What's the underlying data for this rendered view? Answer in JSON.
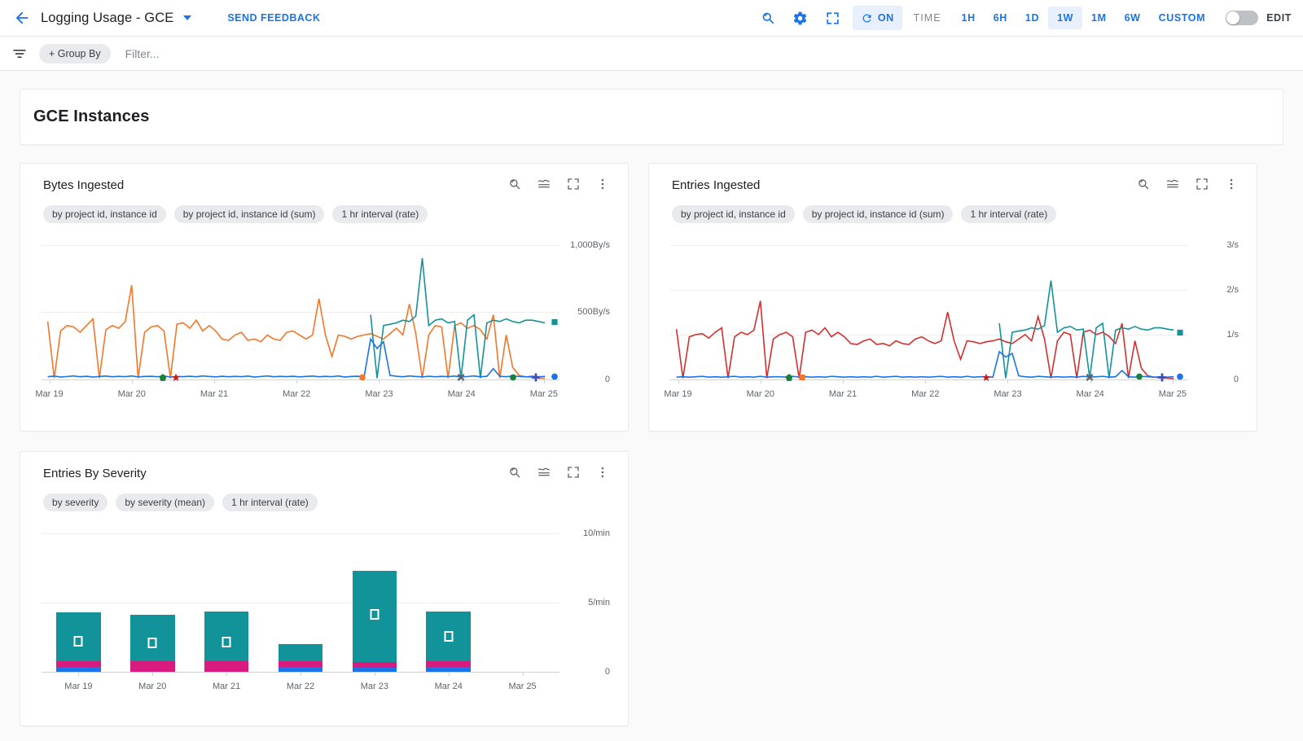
{
  "topbar": {
    "back_icon": "arrow-back-icon",
    "title": "Logging Usage - GCE",
    "caret_icon": "chevron-down-icon",
    "send_feedback": "SEND FEEDBACK",
    "icons": [
      {
        "name": "zoom-out-icon",
        "label": "zoom-out"
      },
      {
        "name": "settings-gear-icon",
        "label": "settings"
      },
      {
        "name": "fullscreen-icon",
        "label": "fullscreen"
      }
    ],
    "auto_refresh": {
      "icon": "refresh-icon",
      "label": "ON"
    },
    "time_label": "TIME",
    "ranges": [
      {
        "label": "1H",
        "active": false
      },
      {
        "label": "6H",
        "active": false
      },
      {
        "label": "1D",
        "active": false
      },
      {
        "label": "1W",
        "active": true
      },
      {
        "label": "1M",
        "active": false
      },
      {
        "label": "6W",
        "active": false
      },
      {
        "label": "CUSTOM",
        "active": false
      }
    ],
    "edit_toggle": {
      "state": "off",
      "label": "EDIT"
    },
    "accent_color": "#1a73e8",
    "active_bg": "#e8f0fe"
  },
  "filterbar": {
    "filter_icon": "filter-list-icon",
    "group_by": "+ Group By",
    "filter_placeholder": "Filter..."
  },
  "section": {
    "title": "GCE Instances"
  },
  "cards": [
    {
      "id": "bytes-ingested",
      "title": "Bytes Ingested",
      "chips": [
        "by project id, instance id",
        "by project id, instance id (sum)",
        "1 hr interval (rate)"
      ],
      "tools": [
        "zoom-out-icon",
        "chart-type-icon",
        "fullscreen-icon",
        "more-vert-icon"
      ]
    },
    {
      "id": "entries-ingested",
      "title": "Entries Ingested",
      "chips": [
        "by project id, instance id",
        "by project id, instance id (sum)",
        "1 hr interval (rate)"
      ],
      "tools": [
        "zoom-out-icon",
        "chart-type-icon",
        "fullscreen-icon",
        "more-vert-icon"
      ]
    },
    {
      "id": "entries-by-severity",
      "title": "Entries By Severity",
      "chips": [
        "by severity",
        "by severity (mean)",
        "1 hr interval (rate)"
      ],
      "tools": [
        "zoom-out-icon",
        "chart-type-icon",
        "fullscreen-icon",
        "more-vert-icon"
      ]
    }
  ],
  "chart_data": [
    {
      "type": "line",
      "title": "Bytes Ingested",
      "xlabel": "",
      "ylabel": "By/s",
      "ylim": [
        0,
        1100
      ],
      "yticks": [
        0,
        500,
        1000
      ],
      "ytick_labels": [
        "0",
        "500By/s",
        "1,000By/s"
      ],
      "grid": true,
      "legend": "none",
      "xticks": [
        "Mar 19",
        "Mar 20",
        "Mar 21",
        "Mar 22",
        "Mar 23",
        "Mar 24",
        "Mar 25"
      ],
      "series": [
        {
          "name": "orange-instance",
          "color": "#f4762a",
          "values": [
            430,
            10,
            360,
            400,
            390,
            350,
            400,
            450,
            10,
            370,
            400,
            380,
            430,
            700,
            10,
            350,
            390,
            400,
            360,
            10,
            410,
            420,
            380,
            440,
            360,
            400,
            360,
            300,
            290,
            330,
            350,
            290,
            300,
            280,
            330,
            300,
            290,
            350,
            360,
            330,
            300,
            330,
            600,
            330,
            170,
            330,
            320,
            300,
            320,
            330,
            340,
            320,
            300,
            340,
            380,
            330,
            560,
            340,
            10,
            330,
            400,
            390,
            10,
            400,
            420,
            380,
            400,
            370,
            300,
            480,
            10,
            330,
            90,
            30,
            20,
            15,
            10,
            8
          ]
        },
        {
          "name": "teal-instance",
          "color": "#12939a",
          "values": [
            null,
            null,
            null,
            null,
            null,
            null,
            null,
            null,
            null,
            null,
            null,
            null,
            null,
            null,
            null,
            null,
            null,
            null,
            null,
            null,
            null,
            null,
            null,
            null,
            null,
            null,
            null,
            null,
            null,
            null,
            null,
            null,
            null,
            null,
            null,
            null,
            null,
            null,
            null,
            null,
            null,
            null,
            null,
            null,
            null,
            null,
            null,
            null,
            null,
            null,
            480,
            10,
            400,
            410,
            420,
            440,
            430,
            470,
            900,
            400,
            440,
            450,
            420,
            430,
            10,
            440,
            480,
            10,
            420,
            440,
            430,
            450,
            430,
            420,
            440,
            440,
            430,
            420
          ]
        },
        {
          "name": "blue-instance",
          "color": "#1a73e8",
          "values": [
            20,
            25,
            18,
            22,
            26,
            20,
            24,
            18,
            22,
            25,
            20,
            23,
            21,
            26,
            19,
            22,
            24,
            20,
            25,
            18,
            22,
            21,
            24,
            20,
            26,
            22,
            19,
            24,
            20,
            23,
            21,
            25,
            18,
            22,
            26,
            20,
            23,
            21,
            24,
            19,
            22,
            25,
            20,
            23,
            21,
            26,
            18,
            22,
            24,
            20,
            300,
            230,
            280,
            30,
            24,
            20,
            26,
            22,
            19,
            24,
            20,
            23,
            21,
            25,
            18,
            22,
            26,
            20,
            23,
            80,
            24,
            20,
            26,
            22,
            19,
            24,
            20,
            22
          ]
        }
      ],
      "markers": [
        {
          "shape": "square",
          "color": "#12939a",
          "x_pct": 99.0,
          "y_value": 415,
          "name": "teal-square-marker"
        },
        {
          "shape": "circle",
          "color": "#1a73e8",
          "x_pct": 99.0,
          "y_value": 14,
          "name": "blue-circle-marker"
        },
        {
          "shape": "pentagon",
          "color": "#188038",
          "x_pct": 23.5,
          "y_value": 6,
          "name": "green-pentagon-marker"
        },
        {
          "shape": "star",
          "color": "#c5221f",
          "x_pct": 26.0,
          "y_value": 6,
          "name": "red-star-marker"
        },
        {
          "shape": "circle",
          "color": "#f4762a",
          "x_pct": 62.0,
          "y_value": 6,
          "name": "orange-circle-marker"
        },
        {
          "shape": "cross",
          "color": "#5f6368",
          "x_pct": 81.0,
          "y_value": 6,
          "name": "gray-cross-marker"
        },
        {
          "shape": "circle",
          "color": "#188038",
          "x_pct": 91.0,
          "y_value": 8,
          "name": "green-circle-marker"
        },
        {
          "shape": "plus",
          "color": "#3f51b5",
          "x_pct": 95.5,
          "y_value": 6,
          "name": "indigo-plus-marker"
        }
      ]
    },
    {
      "type": "line",
      "title": "Entries Ingested",
      "xlabel": "",
      "ylabel": "/s",
      "ylim": [
        0,
        3.3
      ],
      "yticks": [
        0,
        1,
        2,
        3
      ],
      "ytick_labels": [
        "0",
        "1/s",
        "2/s",
        "3/s"
      ],
      "grid": true,
      "legend": "none",
      "xticks": [
        "Mar 19",
        "Mar 20",
        "Mar 21",
        "Mar 22",
        "Mar 23",
        "Mar 24",
        "Mar 25"
      ],
      "series": [
        {
          "name": "red-instance",
          "color": "#d32f2f",
          "values": [
            1.12,
            0.03,
            0.95,
            1.0,
            1.02,
            0.92,
            1.05,
            1.15,
            0.03,
            0.95,
            1.05,
            1.0,
            1.1,
            1.75,
            0.03,
            0.9,
            1.0,
            1.05,
            0.95,
            0.03,
            1.05,
            1.1,
            1.0,
            1.15,
            0.95,
            1.05,
            0.95,
            0.8,
            0.78,
            0.86,
            0.9,
            0.78,
            0.8,
            0.75,
            0.86,
            0.8,
            0.78,
            0.9,
            0.95,
            0.86,
            0.8,
            0.86,
            1.5,
            0.86,
            0.45,
            0.86,
            0.84,
            0.8,
            0.84,
            0.86,
            0.9,
            0.84,
            0.8,
            0.9,
            1.0,
            0.86,
            1.4,
            0.9,
            0.03,
            0.86,
            1.05,
            1.0,
            0.03,
            1.05,
            1.1,
            1.0,
            1.05,
            0.96,
            0.8,
            1.25,
            0.03,
            0.86,
            0.25,
            0.08,
            0.05,
            0.04,
            0.03,
            0.02
          ]
        },
        {
          "name": "teal-instance",
          "color": "#12939a",
          "values": [
            null,
            null,
            null,
            null,
            null,
            null,
            null,
            null,
            null,
            null,
            null,
            null,
            null,
            null,
            null,
            null,
            null,
            null,
            null,
            null,
            null,
            null,
            null,
            null,
            null,
            null,
            null,
            null,
            null,
            null,
            null,
            null,
            null,
            null,
            null,
            null,
            null,
            null,
            null,
            null,
            null,
            null,
            null,
            null,
            null,
            null,
            null,
            null,
            null,
            null,
            1.25,
            0.03,
            1.05,
            1.08,
            1.1,
            1.15,
            1.12,
            1.2,
            2.2,
            1.05,
            1.15,
            1.18,
            1.1,
            1.12,
            0.03,
            1.15,
            1.25,
            0.03,
            1.1,
            1.15,
            1.12,
            1.18,
            1.12,
            1.1,
            1.15,
            1.15,
            1.12,
            1.1
          ]
        },
        {
          "name": "blue-instance",
          "color": "#1a73e8",
          "values": [
            0.05,
            0.06,
            0.05,
            0.06,
            0.07,
            0.05,
            0.06,
            0.05,
            0.06,
            0.07,
            0.05,
            0.06,
            0.05,
            0.07,
            0.05,
            0.06,
            0.06,
            0.05,
            0.07,
            0.05,
            0.06,
            0.05,
            0.06,
            0.05,
            0.07,
            0.06,
            0.05,
            0.06,
            0.05,
            0.06,
            0.05,
            0.07,
            0.05,
            0.06,
            0.07,
            0.05,
            0.06,
            0.05,
            0.06,
            0.05,
            0.06,
            0.07,
            0.05,
            0.06,
            0.05,
            0.07,
            0.05,
            0.06,
            0.06,
            0.05,
            0.62,
            0.5,
            0.58,
            0.08,
            0.06,
            0.05,
            0.07,
            0.06,
            0.05,
            0.06,
            0.05,
            0.06,
            0.05,
            0.07,
            0.05,
            0.06,
            0.07,
            0.05,
            0.06,
            0.2,
            0.06,
            0.05,
            0.07,
            0.06,
            0.05,
            0.06,
            0.05,
            0.06
          ]
        }
      ],
      "markers": [
        {
          "shape": "square",
          "color": "#12939a",
          "x_pct": 98.5,
          "y_value": 1.02,
          "name": "teal-square-marker"
        },
        {
          "shape": "circle",
          "color": "#1a73e8",
          "x_pct": 98.5,
          "y_value": 0.04,
          "name": "blue-circle-marker"
        },
        {
          "shape": "pentagon",
          "color": "#188038",
          "x_pct": 23.0,
          "y_value": 0.02,
          "name": "green-pentagon-marker"
        },
        {
          "shape": "square",
          "color": "#f4762a",
          "x_pct": 25.5,
          "y_value": 0.02,
          "name": "orange-square-marker"
        },
        {
          "shape": "star",
          "color": "#c5221f",
          "x_pct": 61.0,
          "y_value": 0.02,
          "name": "red-star-marker"
        },
        {
          "shape": "cross",
          "color": "#5f6368",
          "x_pct": 81.0,
          "y_value": 0.02,
          "name": "gray-cross-marker"
        },
        {
          "shape": "circle",
          "color": "#188038",
          "x_pct": 90.5,
          "y_value": 0.03,
          "name": "green-circle-marker"
        },
        {
          "shape": "plus",
          "color": "#3f51b5",
          "x_pct": 95.0,
          "y_value": 0.02,
          "name": "indigo-plus-marker"
        }
      ]
    },
    {
      "type": "bar",
      "subtype": "stacked",
      "title": "Entries By Severity",
      "xlabel": "",
      "ylabel": "/min",
      "ylim": [
        0,
        11
      ],
      "yticks": [
        0,
        5,
        10
      ],
      "ytick_labels": [
        "0",
        "5/min",
        "10/min"
      ],
      "grid": true,
      "legend": "none",
      "categories": [
        "Mar 19",
        "Mar 20",
        "Mar 21",
        "Mar 22",
        "Mar 23",
        "Mar 24",
        "Mar 25"
      ],
      "series": [
        {
          "name": "info",
          "color": "#12939a",
          "values": [
            3.5,
            3.35,
            3.55,
            1.25,
            6.6,
            3.55,
            0
          ]
        },
        {
          "name": "warning",
          "color": "#d81b7e",
          "values": [
            0.42,
            0.78,
            0.78,
            0.4,
            0.42,
            0.42,
            0
          ]
        },
        {
          "name": "error",
          "color": "#1a73e8",
          "values": [
            0.36,
            0.0,
            0.0,
            0.34,
            0.3,
            0.36,
            0
          ]
        }
      ],
      "bar_markers": [
        {
          "category": "Mar 19",
          "y_value": 1.85,
          "name": "white-square-marker"
        },
        {
          "category": "Mar 20",
          "y_value": 1.72,
          "name": "white-square-marker"
        },
        {
          "category": "Mar 21",
          "y_value": 1.78,
          "name": "white-square-marker"
        },
        {
          "category": "Mar 23",
          "y_value": 3.75,
          "name": "white-square-marker"
        },
        {
          "category": "Mar 24",
          "y_value": 2.2,
          "name": "white-square-marker"
        }
      ]
    }
  ]
}
